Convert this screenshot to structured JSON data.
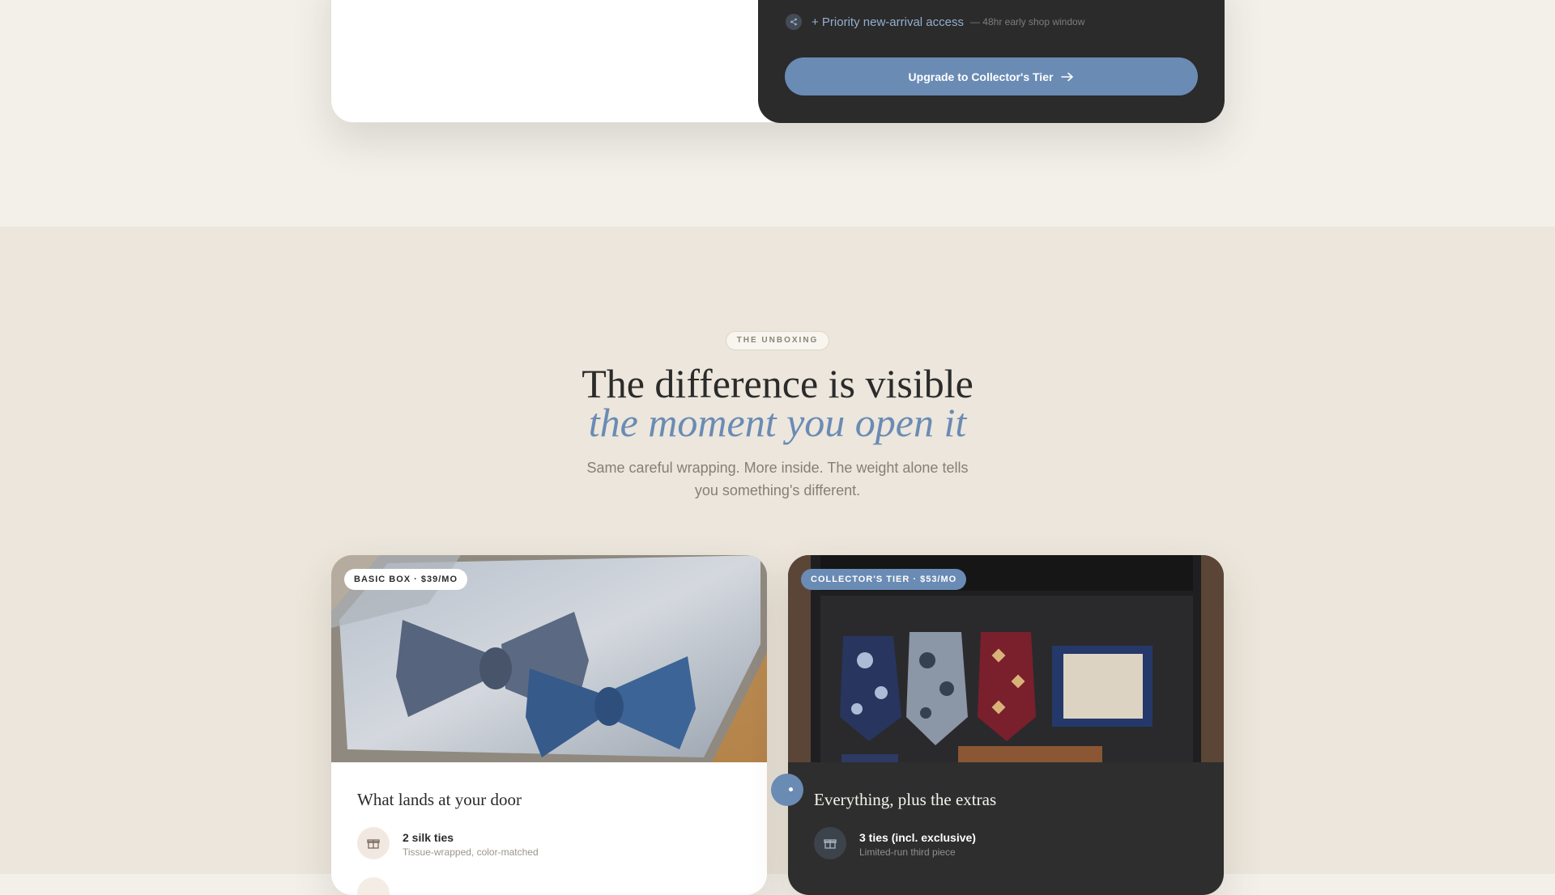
{
  "pricing": {
    "perk": {
      "icon": "share-icon",
      "label": "+ Priority new-arrival access",
      "note": "— 48hr early shop window"
    },
    "upgrade_label": "Upgrade to Collector's Tier"
  },
  "unboxing": {
    "eyebrow": "THE UNBOXING",
    "headline": "The difference is visible",
    "headline_accent": "the moment you open it",
    "subtext": "Same careful wrapping. More inside. The weight alone tells you something's different.",
    "basic_card": {
      "badge": "BASIC BOX · $39/MO",
      "photo": "bow-ties-in-gift-box",
      "title": "What lands at your door",
      "item_icon": "gift-icon",
      "item_title": "2 silk ties",
      "item_sub": "Tissue-wrapped, color-matched"
    },
    "collector_card": {
      "badge": "COLLECTOR'S TIER · $53/MO",
      "photo": "ties-and-pocket-square-in-box",
      "title": "Everything, plus the extras",
      "item_icon": "gift-icon",
      "item_title": "3 ties (incl. exclusive)",
      "item_sub": "Limited-run third piece"
    }
  },
  "colors": {
    "accent": "#6a8bb4",
    "dark_card": "#2b2b2b",
    "page_bg": "#f3f0ea",
    "section_bg": "#ece6dc"
  }
}
